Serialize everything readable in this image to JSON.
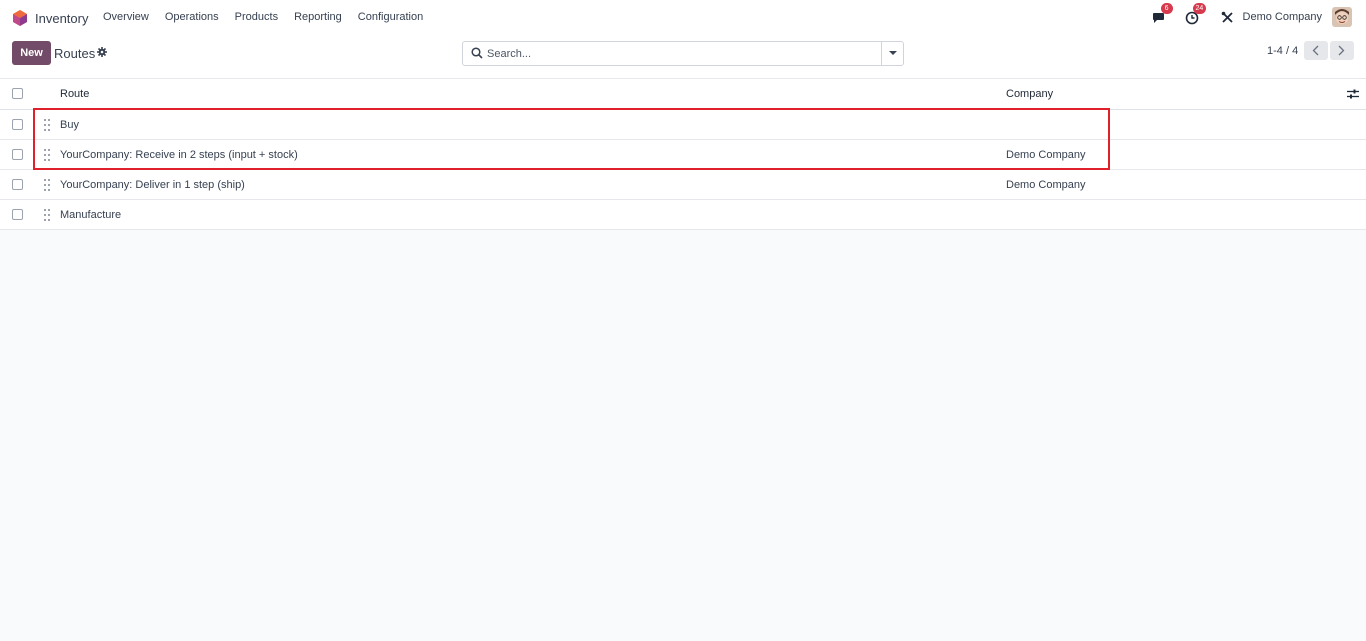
{
  "navbar": {
    "app_name": "Inventory",
    "menu": [
      "Overview",
      "Operations",
      "Products",
      "Reporting",
      "Configuration"
    ],
    "messages_badge": "6",
    "activities_badge": "24",
    "company": "Demo Company"
  },
  "control": {
    "new_label": "New",
    "title": "Routes",
    "search_placeholder": "Search...",
    "pager": "1-4 / 4"
  },
  "table": {
    "columns": {
      "route": "Route",
      "company": "Company"
    },
    "rows": [
      {
        "route": "Buy",
        "company": ""
      },
      {
        "route": "YourCompany: Receive in 2 steps (input + stock)",
        "company": "Demo Company"
      },
      {
        "route": "YourCompany: Deliver in 1 step (ship)",
        "company": "Demo Company"
      },
      {
        "route": "Manufacture",
        "company": ""
      }
    ]
  },
  "colors": {
    "brand": "#714b67",
    "badge": "#d63a4c",
    "highlight": "#e0202a"
  }
}
